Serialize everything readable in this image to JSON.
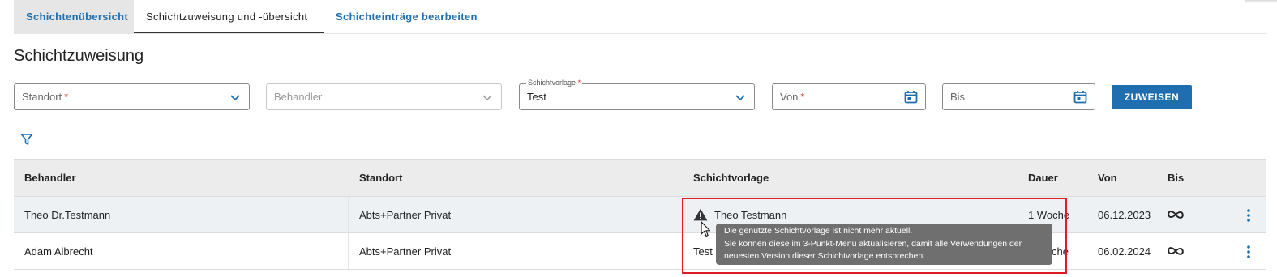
{
  "tabs": [
    {
      "label": "Schichtenübersicht"
    },
    {
      "label": "Schichtzuweisung und -übersicht"
    },
    {
      "label": "Schichteinträge bearbeiten"
    }
  ],
  "page": {
    "title": "Schichtzuweisung"
  },
  "form": {
    "standort": {
      "placeholder": "Standort",
      "required_mark": "*"
    },
    "behandler": {
      "placeholder": "Behandler"
    },
    "schichtvorlage": {
      "label": "Schichtvorlage",
      "required_mark": "*",
      "value": "Test"
    },
    "von": {
      "placeholder": "Von",
      "required_mark": "*"
    },
    "bis": {
      "placeholder": "Bis"
    },
    "assign_label": "ZUWEISEN"
  },
  "table": {
    "headers": {
      "behandler": "Behandler",
      "standort": "Standort",
      "schichtvorlage": "Schichtvorlage",
      "dauer": "Dauer",
      "von": "Von",
      "bis": "Bis"
    },
    "rows": [
      {
        "behandler": "Theo Dr.Testmann",
        "standort": "Abts+Partner Privat",
        "schichtvorlage": "Theo Testmann",
        "dauer": "1 Woche",
        "von": "06.12.2023",
        "bis_icon": "infinity-icon",
        "warning": true
      },
      {
        "behandler": "Adam Albrecht",
        "standort": "Abts+Partner Privat",
        "schichtvorlage": "Test",
        "dauer": "che",
        "von": "06.02.2024",
        "bis_icon": "infinity-icon",
        "warning": false
      }
    ]
  },
  "tooltip": {
    "line1": "Die genutzte Schichtvorlage ist nicht mehr aktuell.",
    "line2": "Sie können diese im 3-Punkt-Menü aktualisieren, damit alle Verwendungen der",
    "line3": "neuesten Version dieser Schichtvorlage entsprechen."
  },
  "colors": {
    "accent": "#1f6fb0",
    "highlight": "#e01b24",
    "required": "#d32f2f",
    "tooltip_bg": "#6f6f6f"
  }
}
